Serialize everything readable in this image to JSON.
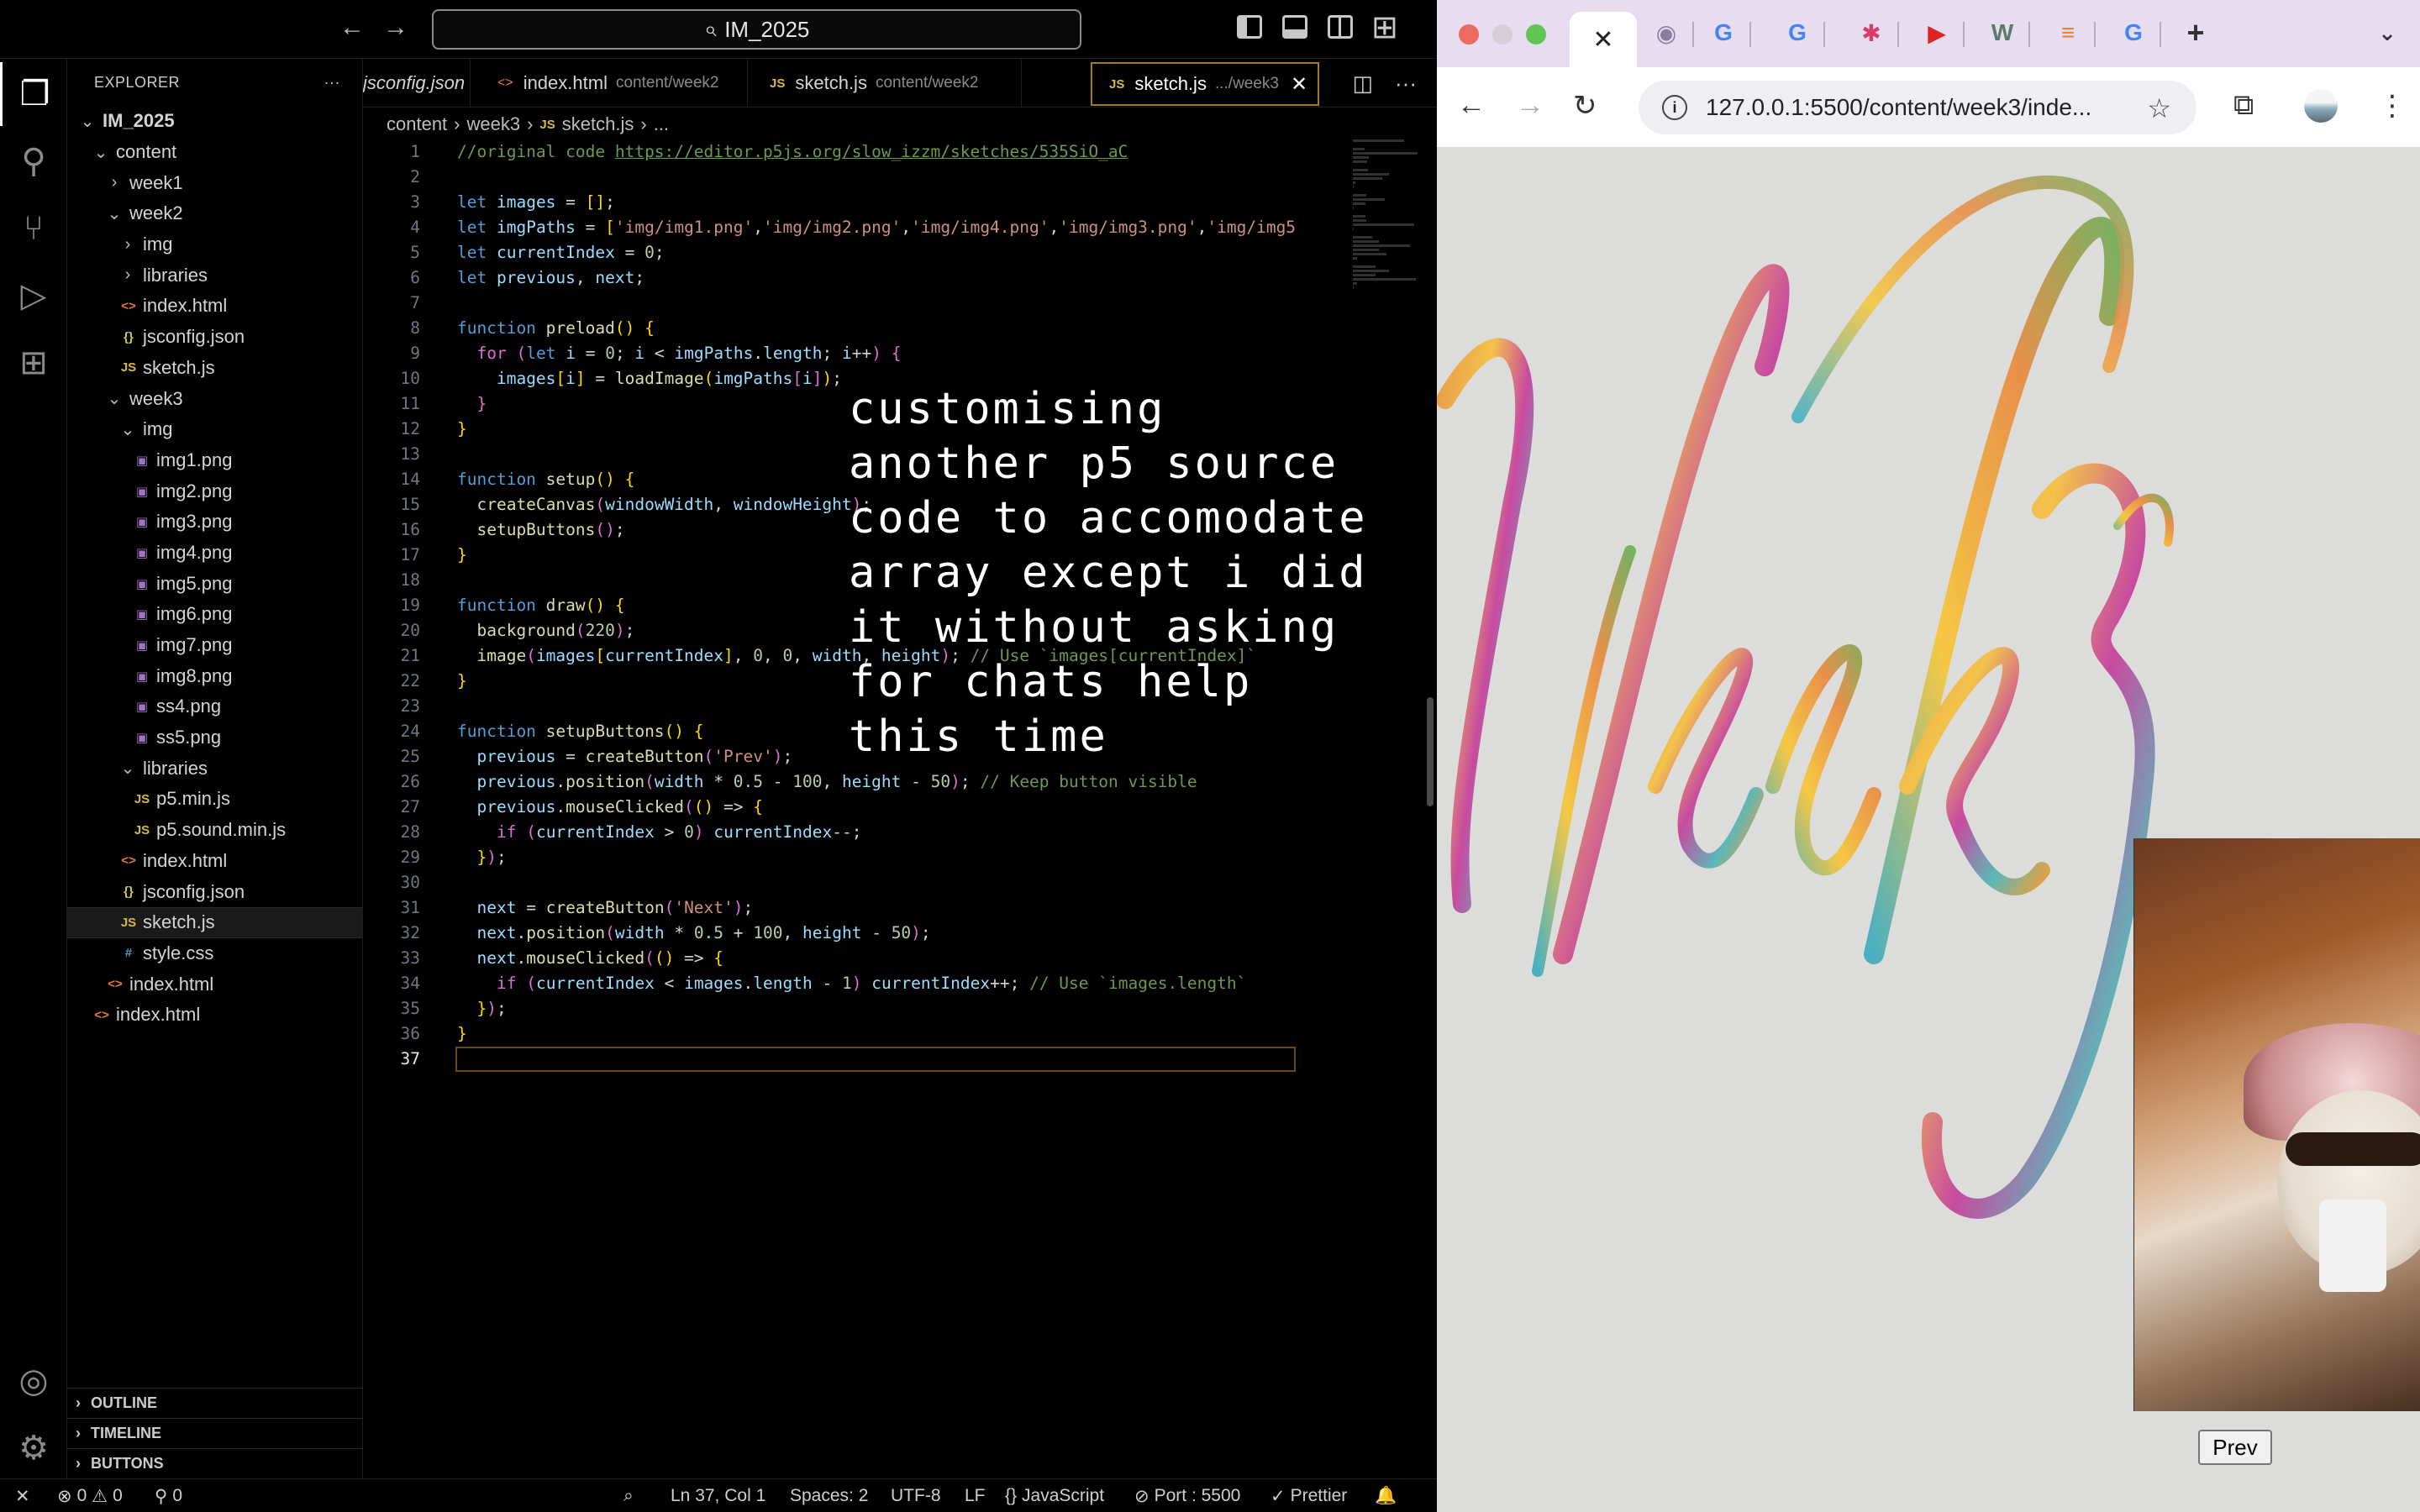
{
  "vscode": {
    "search_label": "IM_2025",
    "explorer": {
      "title": "EXPLORER",
      "tree": [
        {
          "label": "IM_2025",
          "indent": 0,
          "chevron": "⌄",
          "icon": ""
        },
        {
          "label": "content",
          "indent": 1,
          "chevron": "⌄",
          "icon": ""
        },
        {
          "label": "week1",
          "indent": 2,
          "chevron": "›",
          "icon": ""
        },
        {
          "label": "week2",
          "indent": 2,
          "chevron": "⌄",
          "icon": ""
        },
        {
          "label": "img",
          "indent": 3,
          "chevron": "›",
          "icon": ""
        },
        {
          "label": "libraries",
          "indent": 3,
          "chevron": "›",
          "icon": ""
        },
        {
          "label": "index.html",
          "indent": 3,
          "chevron": "",
          "icon": "html"
        },
        {
          "label": "jsconfig.json",
          "indent": 3,
          "chevron": "",
          "icon": "json"
        },
        {
          "label": "sketch.js",
          "indent": 3,
          "chevron": "",
          "icon": "js"
        },
        {
          "label": "week3",
          "indent": 2,
          "chevron": "⌄",
          "icon": ""
        },
        {
          "label": "img",
          "indent": 3,
          "chevron": "⌄",
          "icon": ""
        },
        {
          "label": "img1.png",
          "indent": 4,
          "chevron": "",
          "icon": "png"
        },
        {
          "label": "img2.png",
          "indent": 4,
          "chevron": "",
          "icon": "png"
        },
        {
          "label": "img3.png",
          "indent": 4,
          "chevron": "",
          "icon": "png"
        },
        {
          "label": "img4.png",
          "indent": 4,
          "chevron": "",
          "icon": "png"
        },
        {
          "label": "img5.png",
          "indent": 4,
          "chevron": "",
          "icon": "png"
        },
        {
          "label": "img6.png",
          "indent": 4,
          "chevron": "",
          "icon": "png"
        },
        {
          "label": "img7.png",
          "indent": 4,
          "chevron": "",
          "icon": "png"
        },
        {
          "label": "img8.png",
          "indent": 4,
          "chevron": "",
          "icon": "png"
        },
        {
          "label": "ss4.png",
          "indent": 4,
          "chevron": "",
          "icon": "png"
        },
        {
          "label": "ss5.png",
          "indent": 4,
          "chevron": "",
          "icon": "png"
        },
        {
          "label": "libraries",
          "indent": 3,
          "chevron": "⌄",
          "icon": ""
        },
        {
          "label": "p5.min.js",
          "indent": 4,
          "chevron": "",
          "icon": "js"
        },
        {
          "label": "p5.sound.min.js",
          "indent": 4,
          "chevron": "",
          "icon": "js"
        },
        {
          "label": "index.html",
          "indent": 3,
          "chevron": "",
          "icon": "html"
        },
        {
          "label": "jsconfig.json",
          "indent": 3,
          "chevron": "",
          "icon": "json"
        },
        {
          "label": "sketch.js",
          "indent": 3,
          "chevron": "",
          "icon": "js",
          "selected": true
        },
        {
          "label": "style.css",
          "indent": 3,
          "chevron": "",
          "icon": "css"
        },
        {
          "label": "index.html",
          "indent": 2,
          "chevron": "",
          "icon": "html"
        },
        {
          "label": "index.html",
          "indent": 1,
          "chevron": "",
          "icon": "html"
        }
      ],
      "panels": [
        "OUTLINE",
        "TIMELINE",
        "BUTTONS"
      ]
    },
    "tabs": [
      {
        "label": "jsconfig.json",
        "path": "",
        "icon": ""
      },
      {
        "label": "index.html",
        "path": "content/week2",
        "icon": "html"
      },
      {
        "label": "sketch.js",
        "path": "content/week2",
        "icon": "js"
      },
      {
        "label": "sketch.js",
        "path": ".../week3",
        "icon": "js",
        "active": true
      }
    ],
    "breadcrumb": [
      "content",
      "week3",
      "sketch.js",
      "..."
    ],
    "code_lines": [
      "<span class=\"c\">//original code </span><span class=\"cu\">https://editor.p5js.org/slow_izzm/sketches/535SiO_aC</span>",
      "",
      "<span class=\"k\">let</span> <span class=\"v\">images</span> = <span class=\"br\">[]</span>;",
      "<span class=\"k\">let</span> <span class=\"v\">imgPaths</span> = <span class=\"br\">[</span><span class=\"s\">'img/img1.png'</span>,<span class=\"s\">'img/img2.png'</span>,<span class=\"s\">'img/img4.png'</span>,<span class=\"s\">'img/img3.png'</span>,<span class=\"s\">'img/img5</span>",
      "<span class=\"k\">let</span> <span class=\"v\">currentIndex</span> = <span class=\"n\">0</span>;",
      "<span class=\"k\">let</span> <span class=\"v\">previous</span>, <span class=\"v\">next</span>;",
      "",
      "<span class=\"k\">function</span> <span class=\"f\">preload</span><span class=\"br\">()</span> <span class=\"br\">{</span>",
      "  <span class=\"bp\">for</span> <span class=\"bp\">(</span><span class=\"k\">let</span> <span class=\"v\">i</span> = <span class=\"n\">0</span>; <span class=\"v\">i</span> &lt; <span class=\"v\">imgPaths</span>.<span class=\"v\">length</span>; <span class=\"v\">i</span>++<span class=\"bp\">)</span> <span class=\"bp\">{</span>",
      "    <span class=\"v\">images</span><span class=\"br\">[</span><span class=\"v\">i</span><span class=\"br\">]</span> = <span class=\"f\">loadImage</span><span class=\"br\">(</span><span class=\"v\">imgPaths</span><span class=\"bp\">[</span><span class=\"v\">i</span><span class=\"bp\">]</span><span class=\"br\">)</span>;",
      "  <span class=\"bp\">}</span>",
      "<span class=\"br\">}</span>",
      "",
      "<span class=\"k\">function</span> <span class=\"f\">setup</span><span class=\"br\">()</span> <span class=\"br\">{</span>",
      "  <span class=\"f\">createCanvas</span><span class=\"bp\">(</span><span class=\"v\">windowWidth</span>, <span class=\"v\">windowHeight</span><span class=\"bp\">)</span>;",
      "  <span class=\"f\">setupButtons</span><span class=\"bp\">()</span>;",
      "<span class=\"br\">}</span>",
      "",
      "<span class=\"k\">function</span> <span class=\"f\">draw</span><span class=\"br\">()</span> <span class=\"br\">{</span>",
      "  <span class=\"f\">background</span><span class=\"bp\">(</span><span class=\"n\">220</span><span class=\"bp\">)</span>;",
      "  <span class=\"f\">image</span><span class=\"bp\">(</span><span class=\"v\">images</span><span class=\"br\">[</span><span class=\"v\">currentIndex</span><span class=\"br\">]</span>, <span class=\"n\">0</span>, <span class=\"n\">0</span>, <span class=\"v\">width</span>, <span class=\"v\">height</span><span class=\"bp\">)</span>; <span class=\"c\">// Use `images[currentIndex]`</span>",
      "<span class=\"br\">}</span>",
      "",
      "<span class=\"k\">function</span> <span class=\"f\">setupButtons</span><span class=\"br\">()</span> <span class=\"br\">{</span>",
      "  <span class=\"v\">previous</span> = <span class=\"f\">createButton</span><span class=\"bp\">(</span><span class=\"s\">'Prev'</span><span class=\"bp\">)</span>;",
      "  <span class=\"v\">previous</span>.<span class=\"f\">position</span><span class=\"bp\">(</span><span class=\"v\">width</span> * <span class=\"n\">0.5</span> - <span class=\"n\">100</span>, <span class=\"v\">height</span> - <span class=\"n\">50</span><span class=\"bp\">)</span>; <span class=\"c\">// Keep button visible</span>",
      "  <span class=\"v\">previous</span>.<span class=\"f\">mouseClicked</span><span class=\"bp\">(</span><span class=\"br\">()</span> =&gt; <span class=\"br\">{</span>",
      "    <span class=\"bp\">if</span> <span class=\"bp\">(</span><span class=\"v\">currentIndex</span> &gt; <span class=\"n\">0</span><span class=\"bp\">)</span> <span class=\"v\">currentIndex</span>--;",
      "  <span class=\"br\">}</span><span class=\"bp\">)</span>;",
      "",
      "  <span class=\"v\">next</span> = <span class=\"f\">createButton</span><span class=\"bp\">(</span><span class=\"s\">'Next'</span><span class=\"bp\">)</span>;",
      "  <span class=\"v\">next</span>.<span class=\"f\">position</span><span class=\"bp\">(</span><span class=\"v\">width</span> * <span class=\"n\">0.5</span> + <span class=\"n\">100</span>, <span class=\"v\">height</span> - <span class=\"n\">50</span><span class=\"bp\">)</span>;",
      "  <span class=\"v\">next</span>.<span class=\"f\">mouseClicked</span><span class=\"bp\">(</span><span class=\"br\">()</span> =&gt; <span class=\"br\">{</span>",
      "    <span class=\"bp\">if</span> <span class=\"bp\">(</span><span class=\"v\">currentIndex</span> &lt; <span class=\"v\">images</span>.<span class=\"v\">length</span> - <span class=\"n\">1</span><span class=\"bp\">)</span> <span class=\"v\">currentIndex</span>++; <span class=\"c\">// Use `images.length`</span>",
      "  <span class=\"br\">}</span><span class=\"bp\">)</span>;",
      "<span class=\"br\">}</span>",
      ""
    ],
    "current_line": 37,
    "annotation": "customising another p5 source code to accomodate array except i did it without asking for chats help this time",
    "status": {
      "problems_errors": "0",
      "problems_warnings": "0",
      "ports": "0",
      "cursor": "Ln 37, Col 1",
      "spaces": "Spaces: 2",
      "encoding": "UTF-8",
      "eol": "LF",
      "language": "JavaScript",
      "port": "Port : 5500",
      "formatter": "Prettier"
    }
  },
  "browser": {
    "url": "127.0.0.1:5500/content/week3/inde...",
    "prev_button": "Prev",
    "tab_icons": [
      "close-icon",
      "github-icon",
      "google-icon",
      "google-icon",
      "star-icon",
      "youtube-icon",
      "w-icon",
      "stack-icon",
      "google-icon",
      "plus-icon"
    ],
    "artwork_text": "Week 3"
  }
}
